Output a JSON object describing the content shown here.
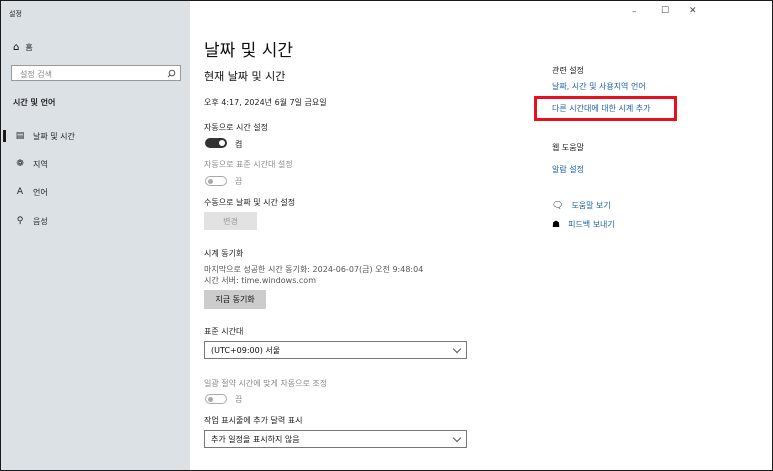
{
  "window": {
    "title": "설정",
    "minimize": "–",
    "maximize": "☐",
    "close": "✕"
  },
  "sidebar": {
    "home_label": "홈",
    "search_placeholder": "설정 검색",
    "section_title": "시간 및 언어",
    "items": [
      {
        "label": "날짜 및 시간",
        "icon": "calendar-clock-icon"
      },
      {
        "label": "지역",
        "icon": "globe-icon"
      },
      {
        "label": "언어",
        "icon": "language-icon"
      },
      {
        "label": "음성",
        "icon": "microphone-icon"
      }
    ]
  },
  "main": {
    "page_title": "날짜 및 시간",
    "current_heading": "현재 날짜 및 시간",
    "current_datetime": "오후 4:17, 2024년 6월 7일 금요일",
    "auto_time": {
      "label": "자동으로 시간 설정",
      "state": "켬"
    },
    "auto_timezone": {
      "label": "자동으로 표준 시간대 설정",
      "state": "끔"
    },
    "manual": {
      "label": "수동으로 날짜 및 시간 설정",
      "button": "변경"
    },
    "sync": {
      "heading": "시계 동기화",
      "last_sync": "마지막으로 성공한 시간 동기화: 2024-06-07(금) 오전 9:48:04",
      "server": "시간 서버: time.windows.com",
      "button": "지금 동기화"
    },
    "timezone": {
      "label": "표준 시간대",
      "value": "(UTC+09:00) 서울"
    },
    "dst": {
      "label": "일광 절약 시간에 맞게 자동으로 조정",
      "state": "끔"
    },
    "taskbar_calendar": {
      "label": "작업 표시줄에 추가 달력 표시",
      "value": "추가 일정을 표시하지 않음"
    }
  },
  "related": {
    "heading": "관련 설정",
    "link1": "날짜, 시간 및 사용지역 언어",
    "link2": "다른 시간대에 대한 시계 추가",
    "highlight_color": "#e8101f"
  },
  "web_help": {
    "heading": "웹 도움말",
    "link": "알람 설정"
  },
  "help": {
    "get_help": "도움말 보기",
    "feedback": "피드백 보내기"
  },
  "colors": {
    "sidebar_bg": "#dce1e6",
    "link": "#1a61a8",
    "toggle_on": "#333333"
  }
}
